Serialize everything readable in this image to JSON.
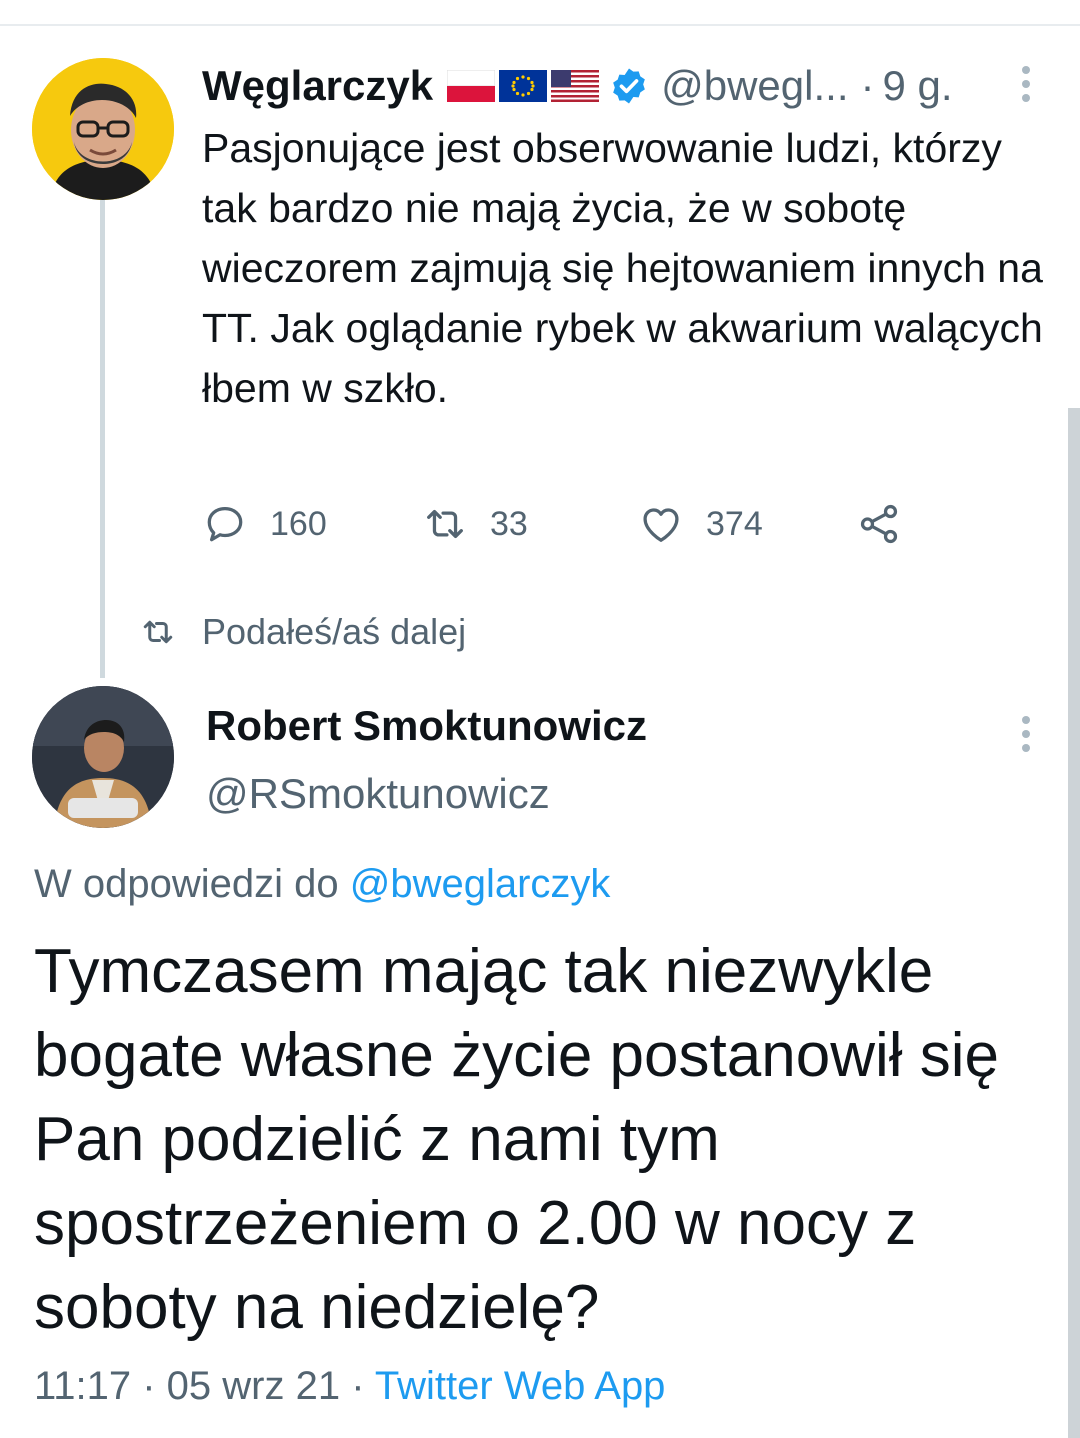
{
  "tweet1": {
    "author_name": "Węglarczyk",
    "flags": [
      "poland-flag",
      "eu-flag",
      "usa-flag"
    ],
    "verified": true,
    "handle": "@bwegl...",
    "separator": "·",
    "time": "9 g.",
    "text": "Pasjonujące jest obserwowanie ludzi, którzy tak bardzo nie mają życia, że w sobotę wieczorem zajmują się hejtowaniem innych na TT. Jak oglądanie rybek w akwarium walących łbem w szkło.",
    "replies": "160",
    "retweets": "33",
    "likes": "374"
  },
  "retweet_notice": "Podałeś/aś dalej",
  "tweet2": {
    "author_name": "Robert Smoktunowicz",
    "handle": "@RSmoktunowicz",
    "reply_prefix": "W odpowiedzi do",
    "reply_mention": "@bweglarczyk",
    "text": "Tymczasem mając tak niezwykle bogate własne życie postanowił się Pan podzielić z nami tym spostrzeżeniem o 2.00 w nocy z soboty na niedzielę?",
    "timestamp": "11:17 · 05 wrz 21 ·",
    "source": "Twitter Web App"
  },
  "colors": {
    "accent": "#1d9bf0",
    "secondary_text": "#536471",
    "primary_text": "#0f1419"
  }
}
